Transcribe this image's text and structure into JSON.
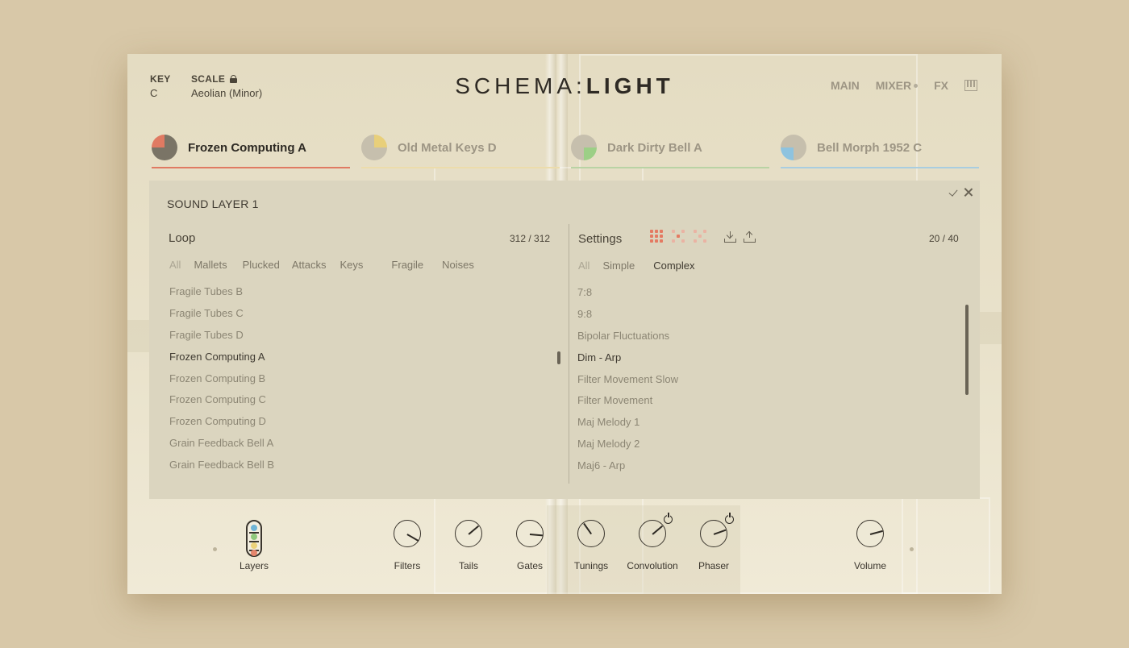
{
  "header": {
    "key_label": "KEY",
    "key_value": "C",
    "scale_label": "SCALE",
    "scale_value": "Aeolian (Minor)",
    "logo_part1": "SCHEMA",
    "logo_sep": ":",
    "logo_part2": "LIGHT",
    "nav": {
      "main": "MAIN",
      "mixer": "MIXER",
      "fx": "FX"
    }
  },
  "tabs": [
    {
      "label": "Frozen Computing A",
      "color": "#e07a62",
      "active": true
    },
    {
      "label": "Old Metal Keys D",
      "color": "#e8cf7a",
      "active": false
    },
    {
      "label": "Dark Dirty Bell A",
      "color": "#9ccf86",
      "active": false
    },
    {
      "label": "Bell Morph 1952 C",
      "color": "#8ec3df",
      "active": false
    }
  ],
  "panel": {
    "title": "SOUND LAYER 1",
    "loop": {
      "title": "Loop",
      "count": "312 / 312",
      "filters": [
        "All",
        "Mallets",
        "Plucked",
        "Attacks",
        "Keys",
        "Fragile",
        "Noises"
      ],
      "items": [
        "Fragile Tubes B",
        "Fragile Tubes C",
        "Fragile Tubes D",
        "Frozen Computing A",
        "Frozen Computing B",
        "Frozen Computing C",
        "Frozen Computing D",
        "Grain Feedback Bell A",
        "Grain Feedback Bell B"
      ],
      "selected_index": 3
    },
    "settings": {
      "title": "Settings",
      "count": "20 / 40",
      "filters": [
        "All",
        "Simple",
        "Complex"
      ],
      "active_filter": 2,
      "items": [
        "7:8",
        "9:8",
        "Bipolar Fluctuations",
        "Dim - Arp",
        "Filter Movement Slow",
        "Filter Movement",
        "Maj Melody 1",
        "Maj Melody 2",
        "Maj6 - Arp"
      ],
      "selected_index": 3
    }
  },
  "controls": {
    "layers": "Layers",
    "filters": "Filters",
    "tails": "Tails",
    "gates": "Gates",
    "tunings": "Tunings",
    "convolution": "Convolution",
    "phaser": "Phaser",
    "volume": "Volume"
  },
  "colors": {
    "accent_red": "#e07a62",
    "accent_yellow": "#e8cf7a",
    "accent_green": "#9ccf86",
    "accent_blue": "#8ec3df"
  }
}
